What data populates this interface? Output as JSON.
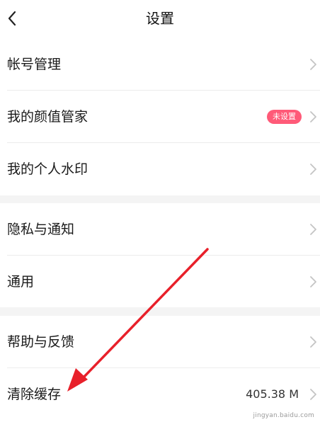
{
  "header": {
    "title": "设置"
  },
  "menu": {
    "account": "帐号管理",
    "beauty": "我的颜值管家",
    "beauty_badge": "未设置",
    "watermark": "我的个人水印",
    "privacy": "隐私与通知",
    "general": "通用",
    "help": "帮助与反馈",
    "cache": "清除缓存",
    "cache_value": "405.38 M"
  },
  "overlay": {
    "watermark_text": "jingyan.baidu.com"
  },
  "colors": {
    "badge": "#ff5a78",
    "annotation_arrow": "#e8202a",
    "section_gap": "#f4f4f4"
  },
  "icons": {
    "back": "chevron-left-icon",
    "row": "chevron-right-icon"
  }
}
